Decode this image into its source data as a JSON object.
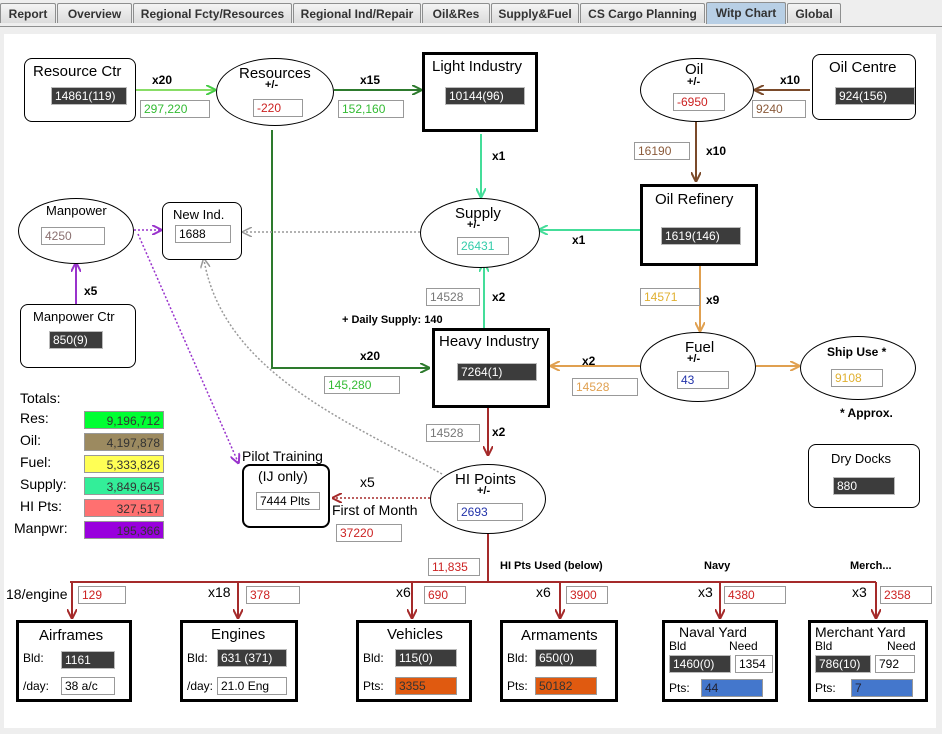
{
  "tabs": [
    {
      "label": "Report",
      "active": false
    },
    {
      "label": "Overview",
      "active": false
    },
    {
      "label": "Regional Fcty/Resources",
      "active": false
    },
    {
      "label": "Regional Ind/Repair",
      "active": false
    },
    {
      "label": "Oil&Res",
      "active": false
    },
    {
      "label": "Supply&Fuel",
      "active": false
    },
    {
      "label": "CS Cargo Planning",
      "active": false
    },
    {
      "label": "Witp Chart",
      "active": true
    },
    {
      "label": "Global",
      "active": false
    }
  ],
  "nodes": {
    "resource_ctr": {
      "title": "Resource Ctr",
      "value": "14861(119)"
    },
    "resources": {
      "title": "Resources",
      "sub": "+/-",
      "value": "-220"
    },
    "light_industry": {
      "title": "Light Industry",
      "value": "10144(96)"
    },
    "oil": {
      "title": "Oil",
      "sub": "+/-",
      "value": "-6950"
    },
    "oil_centre": {
      "title": "Oil Centre",
      "value": "924(156)"
    },
    "manpower": {
      "title": "Manpower",
      "value": "4250"
    },
    "new_ind": {
      "title": "New Ind.",
      "value": "1688"
    },
    "supply": {
      "title": "Supply",
      "sub": "+/-",
      "value": "26431"
    },
    "oil_refinery": {
      "title": "Oil Refinery",
      "value": "1619(146)"
    },
    "manpower_ctr": {
      "title": "Manpower Ctr",
      "value": "850(9)"
    },
    "heavy_industry": {
      "title": "Heavy Industry",
      "value": "7264(1)"
    },
    "fuel": {
      "title": "Fuel",
      "sub": "+/-",
      "value": "43"
    },
    "ship_use": {
      "title": "Ship Use *",
      "value": "9108",
      "note": "* Approx."
    },
    "dry_docks": {
      "title": "Dry Docks",
      "value": "880"
    },
    "hi_points": {
      "title": "HI Points",
      "sub": "+/-",
      "value": "2693"
    },
    "pilot_training": {
      "title": "Pilot Training",
      "sub": "(IJ only)",
      "value": "7444 Plts"
    }
  },
  "flows": {
    "res_ctr_mult": "x20",
    "res_ctr_val": "297,220",
    "res_li_mult": "x15",
    "res_li_val": "152,160",
    "oilc_mult": "x10",
    "oilc_val": "9240",
    "oil_ref_mult": "x10",
    "oil_ref_val": "16190",
    "li_supply_mult": "x1",
    "ref_supply_mult": "x1",
    "ref_fuel_mult": "x9",
    "ref_fuel_val": "14571",
    "mp_mult": "x5",
    "hi_supply_mult": "x2",
    "hi_supply_val": "14528",
    "daily_supply": "+ Daily Supply: 140",
    "res_hi_mult": "x20",
    "res_hi_val": "145,280",
    "fuel_hi_mult": "x2",
    "fuel_hi_val": "14528",
    "hi_hip_mult": "x2",
    "hi_hip_val": "14528",
    "pilot_mult": "x5",
    "first_of_month": "First of Month",
    "first_of_month_val": "37220",
    "hi_used_val": "11,835",
    "hi_used_label": "HI Pts Used (below)"
  },
  "totals": {
    "title": "Totals:",
    "rows": [
      {
        "label": "Res:",
        "value": "9,196,712",
        "color": "#00ff33"
      },
      {
        "label": "Oil:",
        "value": "4,197,878",
        "color": "#9c8a60"
      },
      {
        "label": "Fuel:",
        "value": "5,333,826",
        "color": "#ffff55"
      },
      {
        "label": "Supply:",
        "value": "3,849,645",
        "color": "#33ee99"
      },
      {
        "label": "HI Pts:",
        "value": "327,517",
        "color": "#ff7070"
      },
      {
        "label": "Manpwr:",
        "value": "195,366",
        "color": "#9900dd"
      }
    ]
  },
  "bottom": {
    "navy_label": "Navy",
    "merch_label": "Merch...",
    "airframes": {
      "mult": "18/engine",
      "cost": "129",
      "title": "Airframes",
      "bld_label": "Bld:",
      "bld": "1161",
      "day_label": "/day:",
      "day": "38 a/c"
    },
    "engines": {
      "mult": "x18",
      "cost": "378",
      "title": "Engines",
      "bld_label": "Bld:",
      "bld": "631 (371)",
      "day_label": "/day:",
      "day": "21.0 Eng"
    },
    "vehicles": {
      "mult": "x6",
      "cost": "690",
      "title": "Vehicles",
      "bld_label": "Bld:",
      "bld": "115(0)",
      "pts_label": "Pts:",
      "pts": "3355"
    },
    "armaments": {
      "mult": "x6",
      "cost": "3900",
      "title": "Armaments",
      "bld_label": "Bld:",
      "bld": "650(0)",
      "pts_label": "Pts:",
      "pts": "50182"
    },
    "naval_yard": {
      "mult": "x3",
      "cost": "4380",
      "title": "Naval Yard",
      "bld_label": "Bld",
      "need_label": "Need",
      "bld": "1460(0)",
      "need": "1354",
      "pts_label": "Pts:",
      "pts": "44"
    },
    "merchant_yard": {
      "mult": "x3",
      "cost": "2358",
      "title": "Merchant Yard",
      "bld_label": "Bld",
      "need_label": "Need",
      "bld": "786(10)",
      "need": "792",
      "pts_label": "Pts:",
      "pts": "7"
    }
  },
  "colors": {
    "green": "#44cc44",
    "dkgreen": "#2d7a2d",
    "teal": "#55ddaa",
    "brown": "#8a5a3a",
    "orange": "#e0a050",
    "purple": "#9933cc",
    "gray": "#999999",
    "red": "#a52a2a"
  }
}
